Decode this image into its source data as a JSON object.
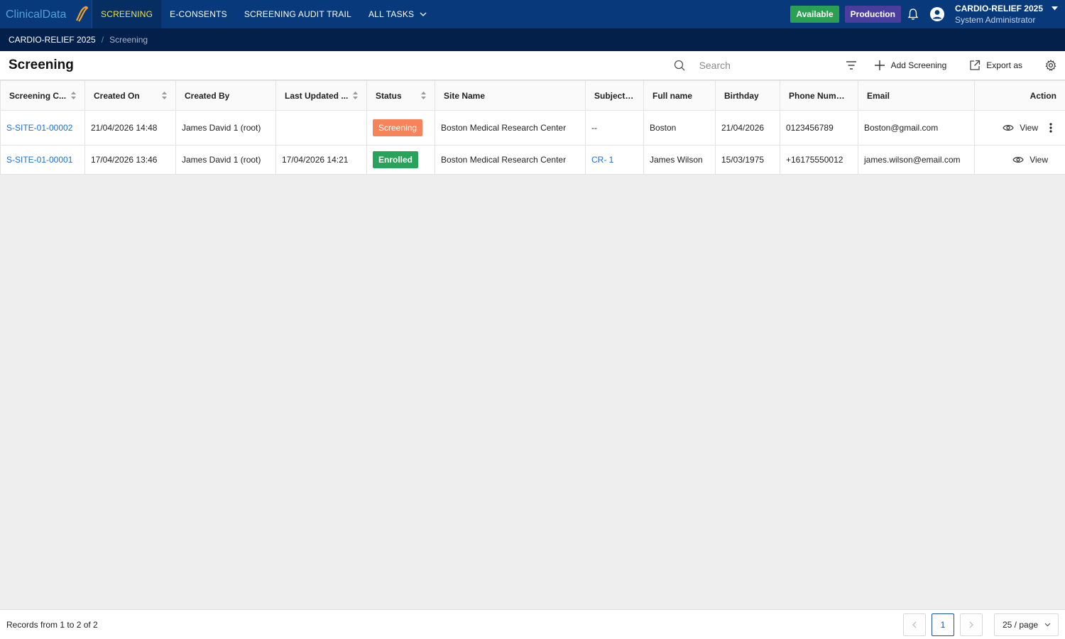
{
  "app": {
    "logo_text": "ClinicalData"
  },
  "nav": {
    "items": [
      {
        "label": "SCREENING",
        "active": true
      },
      {
        "label": "E-CONSENTS",
        "active": false
      },
      {
        "label": "SCREENING AUDIT TRAIL",
        "active": false
      },
      {
        "label": "ALL TASKS",
        "active": false
      }
    ]
  },
  "header": {
    "available_badge": "Available",
    "env_badge": "Production",
    "study_name": "CARDIO-RELIEF 2025",
    "user_role": "System Administrator"
  },
  "breadcrumb": {
    "root": "CARDIO-RELIEF 2025",
    "separator": "/",
    "current": "Screening"
  },
  "page": {
    "title": "Screening"
  },
  "toolbar": {
    "search_placeholder": "Search",
    "add_label": "Add Screening",
    "export_label": "Export as"
  },
  "table": {
    "columns": [
      "Screening C...",
      "Created On",
      "Created By",
      "Last Updated ...",
      "Status",
      "Site Name",
      "Subject ID",
      "Full name",
      "Birthday",
      "Phone Number",
      "Email",
      "Action"
    ],
    "rows": [
      {
        "code": "S-SITE-01-00002",
        "created_on": "21/04/2026 14:48",
        "created_by": "James David 1 (root)",
        "last_updated": "",
        "status": "Screening",
        "site_name": "Boston Medical Research Center",
        "subject_id": "--",
        "full_name": "Boston",
        "birthday": "21/04/2026",
        "phone": "0123456789",
        "email": "Boston@gmail.com",
        "action": "View"
      },
      {
        "code": "S-SITE-01-00001",
        "created_on": "17/04/2026 13:46",
        "created_by": "James David 1 (root)",
        "last_updated": "17/04/2026 14:21",
        "status": "Enrolled",
        "site_name": "Boston Medical Research Center",
        "subject_id": "CR- 1",
        "full_name": "James Wilson",
        "birthday": "15/03/1975",
        "phone": "+16175550012",
        "email": "james.wilson@email.com",
        "action": "View"
      }
    ]
  },
  "footer": {
    "records_text": "Records from 1 to 2 of 2",
    "current_page": "1",
    "page_size": "25 / page"
  },
  "colors": {
    "nav_bg": "#083a7b",
    "breadcrumb_bg": "#03204a",
    "active_nav_text": "#f2e44a",
    "available": "#2aa152",
    "production": "#4b3d9e",
    "status_screening": "#f7835a",
    "status_enrolled": "#27a35a",
    "link": "#1d6fcf"
  }
}
